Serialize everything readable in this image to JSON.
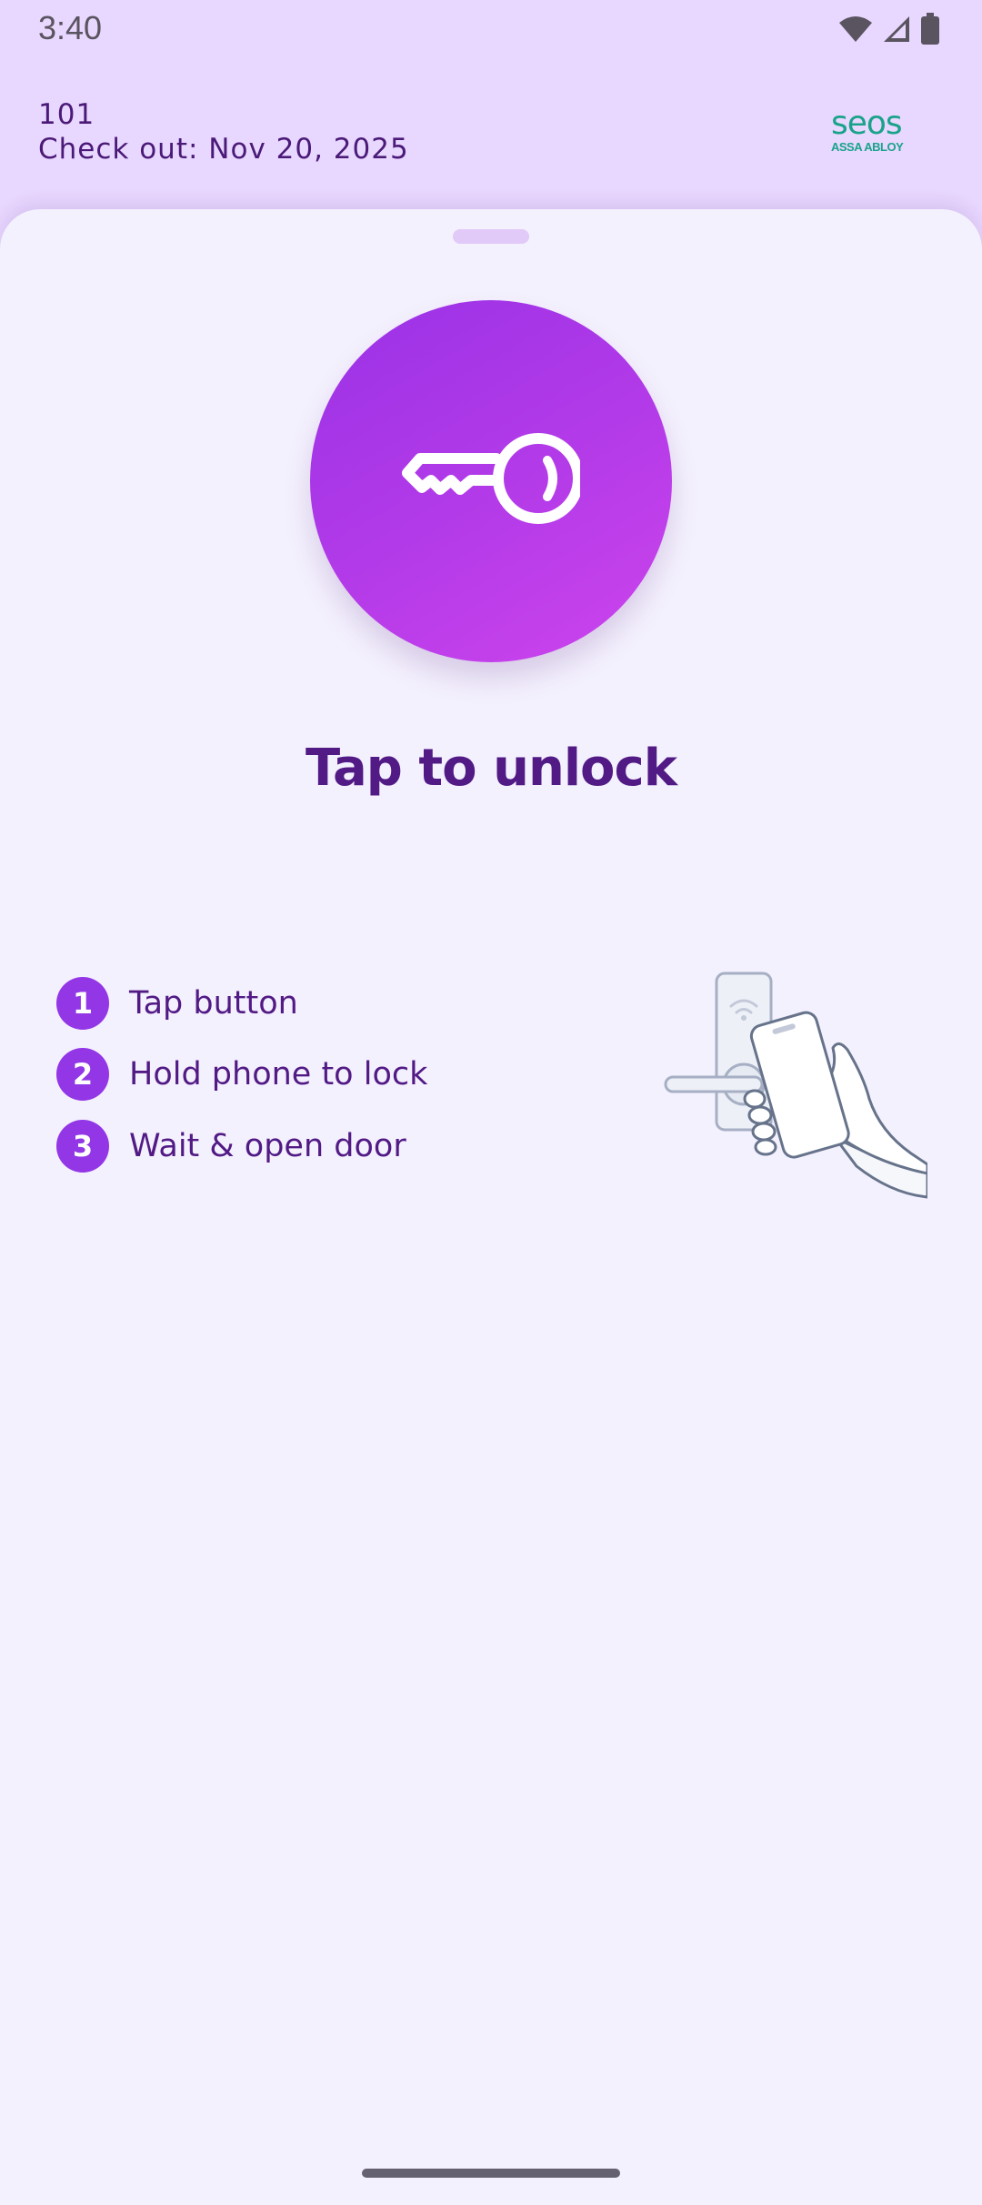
{
  "status_bar": {
    "time": "3:40",
    "icons": [
      "wifi-icon",
      "cell-signal-icon",
      "battery-icon"
    ]
  },
  "header": {
    "room": "101",
    "checkout": "Check out: Nov 20, 2025"
  },
  "brand": {
    "name": "seos",
    "sub": "ASSA ABLOY",
    "color": "#1aa38a"
  },
  "unlock": {
    "icon": "key-icon",
    "title": "Tap to unlock"
  },
  "steps": [
    {
      "number": "1",
      "label": "Tap button"
    },
    {
      "number": "2",
      "label": "Hold phone to lock"
    },
    {
      "number": "3",
      "label": "Wait & open door"
    }
  ],
  "illustration": {
    "icon": "phone-to-lock-illustration"
  },
  "colors": {
    "accent": "#9a32e6",
    "title": "#521a85",
    "background": "#f4f1fe",
    "header": "#e8d7fe"
  }
}
